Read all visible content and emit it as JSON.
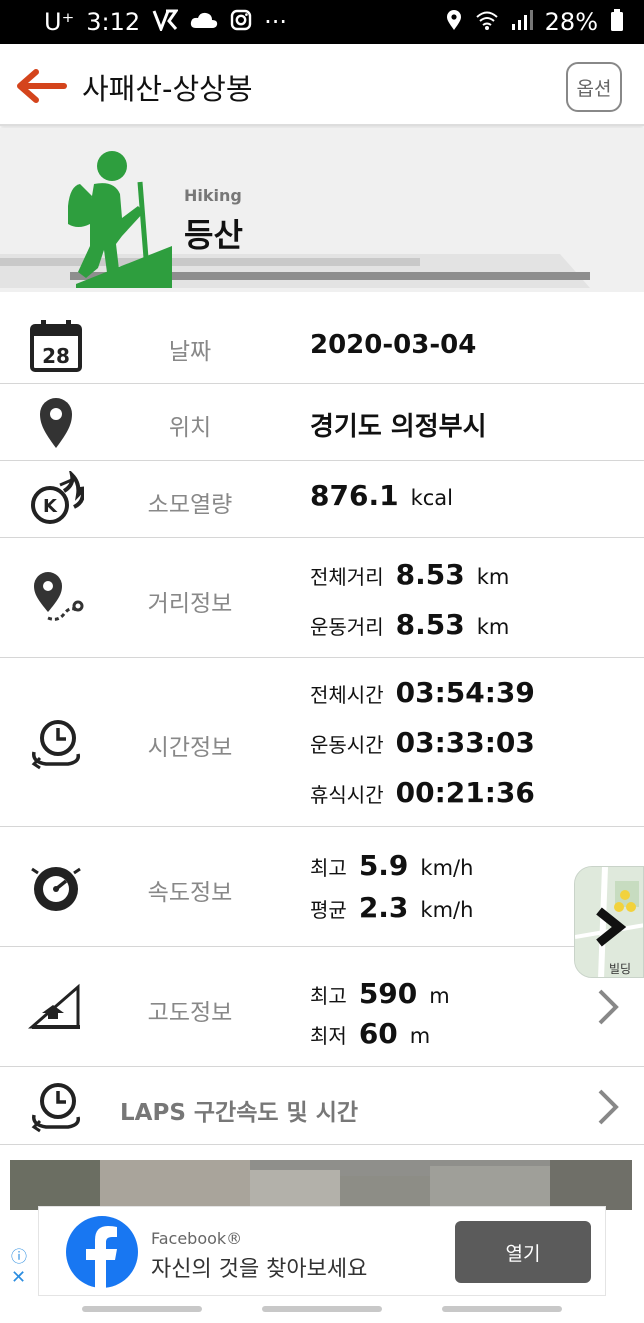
{
  "status_bar": {
    "carrier": "U⁺",
    "time": "3:12",
    "dots": "···",
    "battery": "28%"
  },
  "app_bar": {
    "title": "사패산-상상봉",
    "option_label": "옵션"
  },
  "hero": {
    "activity_en": "Hiking",
    "activity_ko": "등산",
    "accent_color": "#2e9e3e"
  },
  "rows": {
    "date": {
      "icon_day": "28",
      "label": "날짜",
      "value": "2020-03-04"
    },
    "location": {
      "label": "위치",
      "value": "경기도 의정부시"
    },
    "calories": {
      "label": "소모열량",
      "value": "876.1",
      "unit": "kcal"
    },
    "distance": {
      "label": "거리정보",
      "total_label": "전체거리",
      "total_value": "8.53",
      "total_unit": "km",
      "moving_label": "운동거리",
      "moving_value": "8.53",
      "moving_unit": "km"
    },
    "time": {
      "label": "시간정보",
      "total_label": "전체시간",
      "total_value": "03:54:39",
      "moving_label": "운동시간",
      "moving_value": "03:33:03",
      "rest_label": "휴식시간",
      "rest_value": "00:21:36"
    },
    "speed": {
      "label": "속도정보",
      "max_label": "최고",
      "max_value": "5.9",
      "max_unit": "km/h",
      "avg_label": "평균",
      "avg_value": "2.3",
      "avg_unit": "km/h"
    },
    "altitude": {
      "label": "고도정보",
      "max_label": "최고",
      "max_value": "590",
      "max_unit": "m",
      "min_label": "최저",
      "min_value": "60",
      "min_unit": "m"
    },
    "laps": {
      "label": "LAPS 구간속도 및 시간"
    }
  },
  "ad": {
    "brand": "Facebook®",
    "text": "자신의 것을 찾아보세요",
    "button": "열기",
    "info_icon": "ⓘ",
    "close_icon": "✕"
  },
  "map_thumb": {
    "label": "빌딩"
  },
  "icons": {
    "back": "back-arrow-icon",
    "calendar": "calendar-icon",
    "location": "location-pin-icon",
    "calories": "calorie-fire-icon",
    "distance": "distance-route-icon",
    "time": "clock-cycle-icon",
    "speed": "speedometer-icon",
    "altitude": "altitude-slope-icon",
    "laps": "laps-clock-icon",
    "chevron": "chevron-right-icon"
  },
  "colors": {
    "back_arrow": "#d4441c",
    "label_gray": "#888888",
    "divider": "#d6d6d6",
    "hiking_green": "#2e9e3e"
  }
}
